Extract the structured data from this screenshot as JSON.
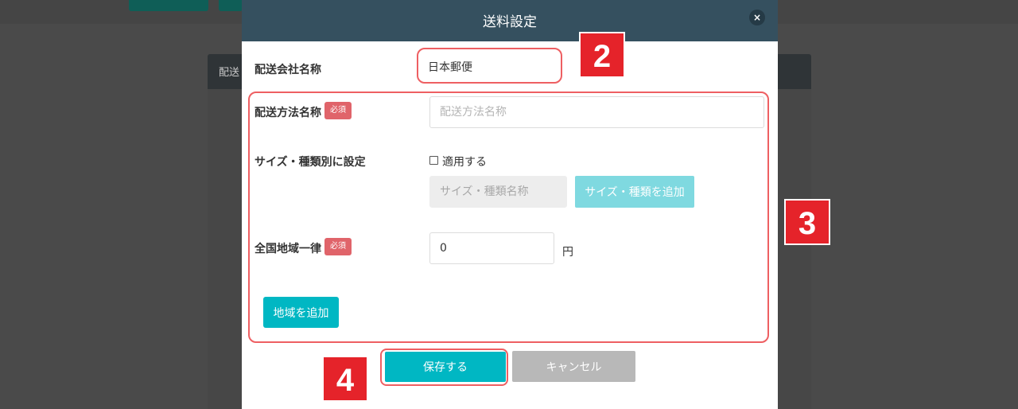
{
  "background": {
    "header_text": "配送"
  },
  "modal": {
    "title": "送料設定",
    "close_icon": "×",
    "company": {
      "label": "配送会社名称",
      "value": "日本郵便"
    },
    "method": {
      "label": "配送方法名称",
      "required_badge": "必須",
      "placeholder": "配送方法名称"
    },
    "size": {
      "label": "サイズ・種類別に設定",
      "checkbox_label": "適用する",
      "checked": false,
      "name_placeholder": "サイズ・種類名称",
      "add_button": "サイズ・種類を追加"
    },
    "nationwide": {
      "label": "全国地域一律",
      "required_badge": "必須",
      "value": "0",
      "unit": "円"
    },
    "add_region_button": "地域を追加",
    "save_button": "保存する",
    "cancel_button": "キャンセル"
  },
  "annotations": {
    "marker_2": "2",
    "marker_3": "3",
    "marker_4": "4"
  },
  "colors": {
    "header": "#35505f",
    "accent": "#00b7c3",
    "accent_light": "#7fd9e0",
    "cancel": "#b8b8b8",
    "badge": "#e0646a",
    "highlight": "#ee5f62",
    "marker": "#e5232a"
  }
}
